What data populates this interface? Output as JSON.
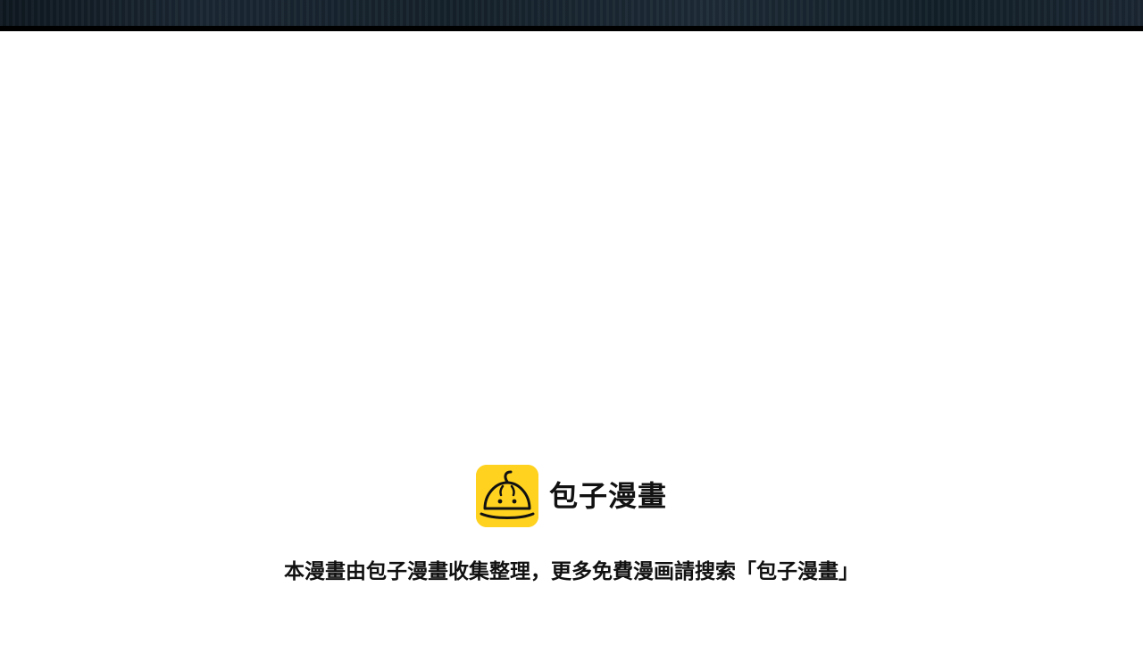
{
  "brand": {
    "name": "包子漫畫",
    "logo_icon": "steamed-bun-icon",
    "logo_color": "#ffd21f"
  },
  "notice": {
    "text": "本漫畫由包子漫畫收集整理，更多免費漫画請搜索「包子漫畫」"
  }
}
